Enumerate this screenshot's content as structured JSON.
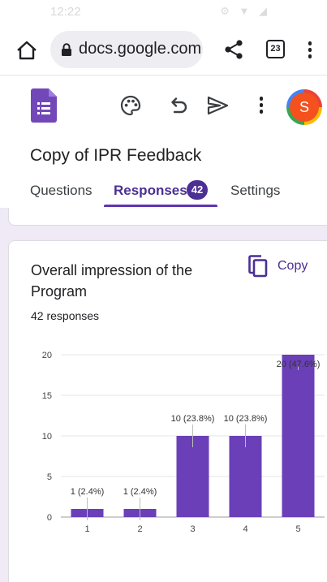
{
  "status_bar": {
    "time": "12:22",
    "indicators": "⚙ ▼ ◢"
  },
  "browser": {
    "url": "docs.google.com",
    "tab_count": "23",
    "icons": [
      "home-icon",
      "lock-icon",
      "share-icon",
      "tabs-icon",
      "more-vert-icon"
    ]
  },
  "app": {
    "avatar_letter": "S",
    "icons": [
      "forms-logo-icon",
      "palette-icon",
      "undo-icon",
      "send-icon",
      "more-vert-icon"
    ],
    "accent_color": "#5e35b1",
    "bar_color": "#6a3fb8"
  },
  "form": {
    "title": "Copy of IPR Feedback",
    "tabs": [
      {
        "label": "Questions",
        "active": false
      },
      {
        "label": "Responses",
        "active": true,
        "badge": "42"
      },
      {
        "label": "Settings",
        "active": false
      }
    ]
  },
  "question": {
    "title": "Overall impression of the Program",
    "copy_label": "Copy",
    "responses_label": "42 responses"
  },
  "chart_data": {
    "type": "bar",
    "categories": [
      "1",
      "2",
      "3",
      "4",
      "5"
    ],
    "values": [
      1,
      1,
      10,
      10,
      20
    ],
    "data_labels": [
      "1 (2.4%)",
      "1 (2.4%)",
      "10 (23.8%)",
      "10 (23.8%)",
      "20 (47.6%)"
    ],
    "y_ticks": [
      "0",
      "5",
      "10",
      "15",
      "20"
    ],
    "ylim": [
      0,
      20
    ],
    "grid": true,
    "color": "#6a3fb8",
    "xlabel": "",
    "ylabel": ""
  }
}
